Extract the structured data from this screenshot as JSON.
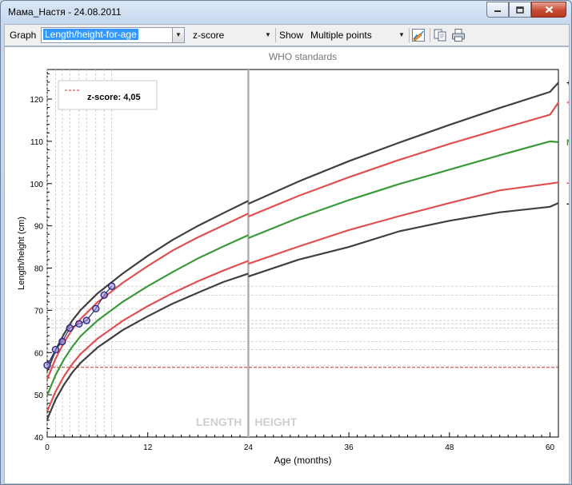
{
  "window": {
    "title": "Мама_Настя - 24.08.2011",
    "controls": [
      "minimize-icon",
      "maximize-icon",
      "close-icon"
    ]
  },
  "toolbar": {
    "graph_label": "Graph",
    "graph_select": "Length/height-for-age",
    "scale_select": "z-score",
    "show_label": "Show",
    "show_select": "Multiple points",
    "icons": [
      "chart-edit-icon",
      "copy-icon",
      "print-icon"
    ]
  },
  "chart_data": {
    "type": "line",
    "title": "WHO standards",
    "xlabel": "Age (months)",
    "ylabel": "Length/height (cm)",
    "xlim": [
      0,
      61
    ],
    "ylim": [
      40,
      127
    ],
    "x_ticks": [
      0,
      12,
      24,
      36,
      48,
      60
    ],
    "y_ticks": [
      40,
      50,
      60,
      70,
      80,
      90,
      100,
      110,
      120
    ],
    "section_labels": [
      "LENGTH",
      "HEIGHT"
    ],
    "section_divider_x": 24,
    "legend": {
      "entry": "z-score: 4,05",
      "position": "top-left"
    },
    "reference_line_y": 56.5,
    "series": [
      {
        "name": "+3SD",
        "color": "#404040",
        "x": [
          0,
          1,
          2,
          3,
          4,
          6,
          9,
          12,
          15,
          18,
          21,
          24
        ],
        "y": [
          55.6,
          60.6,
          64.4,
          67.6,
          70.1,
          74.0,
          78.7,
          82.9,
          86.7,
          90.0,
          93.0,
          95.9
        ],
        "x2": [
          24,
          30,
          36,
          42,
          48,
          54,
          60,
          61
        ],
        "y2": [
          95.2,
          100.5,
          105.3,
          109.7,
          113.9,
          117.9,
          121.7,
          123.9
        ]
      },
      {
        "name": "+2SD",
        "color": "#e05050",
        "x": [
          0,
          1,
          2,
          3,
          4,
          6,
          9,
          12,
          15,
          18,
          21,
          24
        ],
        "y": [
          53.7,
          58.6,
          62.4,
          65.5,
          68.0,
          71.9,
          76.5,
          80.5,
          84.2,
          87.3,
          90.1,
          92.9
        ],
        "x2": [
          24,
          30,
          36,
          42,
          48,
          54,
          60,
          61
        ],
        "y2": [
          92.2,
          97.1,
          101.5,
          105.6,
          109.4,
          112.9,
          116.3,
          119.2
        ]
      },
      {
        "name": "Median",
        "color": "#3a9a3a",
        "x": [
          0,
          1,
          2,
          3,
          4,
          6,
          9,
          12,
          15,
          18,
          21,
          24
        ],
        "y": [
          49.9,
          54.7,
          58.4,
          61.4,
          63.9,
          67.6,
          72.0,
          75.7,
          79.1,
          82.3,
          85.1,
          87.8
        ],
        "x2": [
          24,
          30,
          36,
          42,
          48,
          54,
          60,
          61
        ],
        "y2": [
          87.1,
          91.9,
          96.1,
          99.9,
          103.3,
          106.7,
          110.0,
          109.8
        ]
      },
      {
        "name": "-2SD",
        "color": "#e05050",
        "x": [
          0,
          1,
          2,
          3,
          4,
          6,
          9,
          12,
          15,
          18,
          21,
          24
        ],
        "y": [
          46.1,
          50.8,
          54.4,
          57.3,
          59.7,
          63.3,
          67.5,
          71.0,
          74.1,
          76.9,
          79.4,
          81.7
        ],
        "x2": [
          24,
          30,
          36,
          42,
          48,
          54,
          60,
          61
        ],
        "y2": [
          81.0,
          85.1,
          89.0,
          92.3,
          95.4,
          98.4,
          100.0,
          100.3
        ]
      },
      {
        "name": "-3SD",
        "color": "#404040",
        "x": [
          0,
          1,
          2,
          3,
          4,
          6,
          9,
          12,
          15,
          18,
          21,
          24
        ],
        "y": [
          44.2,
          48.9,
          52.4,
          55.3,
          57.6,
          61.2,
          65.3,
          68.6,
          71.6,
          74.2,
          76.7,
          78.7
        ],
        "x2": [
          24,
          30,
          36,
          42,
          48,
          54,
          60,
          61
        ],
        "y2": [
          78.0,
          82.0,
          85.0,
          88.7,
          91.2,
          93.2,
          94.5,
          95.4
        ]
      }
    ],
    "measurements": {
      "x": [
        0,
        1,
        1.8,
        2.7,
        3.8,
        4.7,
        5.8,
        6.8,
        7.7
      ],
      "y": [
        57.0,
        60.7,
        62.6,
        65.8,
        66.8,
        67.6,
        70.4,
        73.6,
        75.7
      ],
      "color": "#2a2a80"
    }
  }
}
